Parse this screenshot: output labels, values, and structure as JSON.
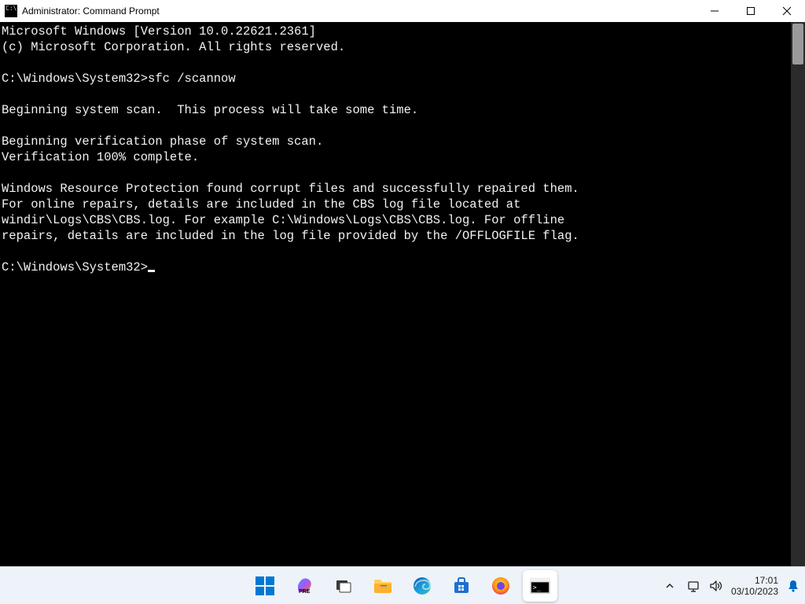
{
  "window": {
    "title": "Administrator: Command Prompt"
  },
  "console": {
    "lines": [
      "Microsoft Windows [Version 10.0.22621.2361]",
      "(c) Microsoft Corporation. All rights reserved.",
      "",
      "C:\\Windows\\System32>sfc /scannow",
      "",
      "Beginning system scan.  This process will take some time.",
      "",
      "Beginning verification phase of system scan.",
      "Verification 100% complete.",
      "",
      "Windows Resource Protection found corrupt files and successfully repaired them.",
      "For online repairs, details are included in the CBS log file located at",
      "windir\\Logs\\CBS\\CBS.log. For example C:\\Windows\\Logs\\CBS\\CBS.log. For offline",
      "repairs, details are included in the log file provided by the /OFFLOGFILE flag.",
      ""
    ],
    "prompt": "C:\\Windows\\System32>"
  },
  "taskbar": {
    "items": [
      {
        "name": "start",
        "label": "Start"
      },
      {
        "name": "copilot",
        "label": "Copilot"
      },
      {
        "name": "task-view",
        "label": "Task View"
      },
      {
        "name": "file-explorer",
        "label": "File Explorer"
      },
      {
        "name": "edge",
        "label": "Microsoft Edge"
      },
      {
        "name": "microsoft-store",
        "label": "Microsoft Store"
      },
      {
        "name": "firefox",
        "label": "Firefox"
      },
      {
        "name": "command-prompt",
        "label": "Command Prompt",
        "active": true
      }
    ]
  },
  "tray": {
    "time": "17:01",
    "date": "03/10/2023"
  }
}
